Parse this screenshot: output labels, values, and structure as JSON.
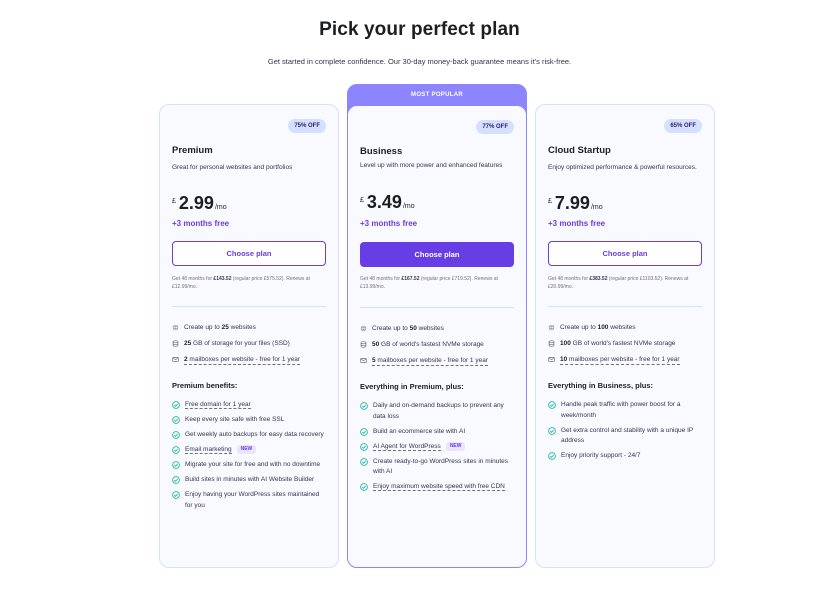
{
  "header": {
    "title": "Pick your perfect plan",
    "subtitle": "Get started in complete confidence. Our 30-day money-back guarantee means it's risk-free."
  },
  "colors": {
    "accent": "#673de6",
    "popular": "#8c85ff",
    "card_bg": "#f9faff",
    "border": "#d5dfff",
    "check": "#00b090"
  },
  "plans": {
    "premium": {
      "discount": "75% OFF",
      "name": "Premium",
      "description": "Great for personal websites and portfolios",
      "currency": "£",
      "price": "2.99",
      "per": "/mo",
      "months_free": "+3 months free",
      "button": "Choose plan",
      "renew_prefix": "Get 48 months for ",
      "renew_amount": "£143.52",
      "renew_suffix": " (regular price £575.52). Renews at £12.99/mo.",
      "features": [
        {
          "pre": "Create up to ",
          "bold": "25",
          "post": " websites",
          "icon": "globe-icon"
        },
        {
          "pre": "",
          "bold": "25",
          "post": " GB of storage for your files (SSD)",
          "icon": "storage-icon"
        },
        {
          "pre": "",
          "bold": "2",
          "post": " mailboxes per website - free for 1 year",
          "icon": "mail-icon"
        }
      ],
      "benefits_title": "Premium benefits:",
      "benefits": [
        {
          "text": "Free domain for 1 year",
          "new": ""
        },
        {
          "text": "Keep every site safe with free SSL",
          "new": ""
        },
        {
          "text": "Get weekly auto backups for easy data recovery",
          "new": ""
        },
        {
          "text": "Email marketing",
          "new": "NEW"
        },
        {
          "text": "Migrate your site for free and with no downtime",
          "new": ""
        },
        {
          "text": "Build sites in minutes with AI Website Builder",
          "new": ""
        },
        {
          "text": "Enjoy having your WordPress sites maintained for you",
          "new": ""
        }
      ]
    },
    "business": {
      "banner": "MOST POPULAR",
      "discount": "77% OFF",
      "name": "Business",
      "description": "Level up with more power and enhanced features",
      "currency": "£",
      "price": "3.49",
      "per": "/mo",
      "months_free": "+3 months free",
      "button": "Choose plan",
      "renew_prefix": "Get 48 months for ",
      "renew_amount": "£167.52",
      "renew_suffix": " (regular price £719.52). Renews at £13.99/mo.",
      "features": [
        {
          "pre": "Create up to ",
          "bold": "50",
          "post": " websites",
          "icon": "globe-icon"
        },
        {
          "pre": "",
          "bold": "50",
          "post": " GB of world's fastest NVMe storage",
          "icon": "storage-icon"
        },
        {
          "pre": "",
          "bold": "5",
          "post": " mailboxes per website - free for 1 year",
          "icon": "mail-icon"
        }
      ],
      "benefits_title": "Everything in Premium, plus:",
      "benefits": [
        {
          "text": "Daily and on-demand backups to prevent any data loss",
          "new": ""
        },
        {
          "text": "Build an ecommerce site with AI",
          "new": ""
        },
        {
          "text": "AI Agent for WordPress",
          "new": "NEW"
        },
        {
          "text": "Create ready-to-go WordPress sites in minutes with AI",
          "new": ""
        },
        {
          "text": "Enjoy maximum website speed with free CDN",
          "new": ""
        }
      ]
    },
    "cloud": {
      "discount": "65% OFF",
      "name": "Cloud Startup",
      "description": "Enjoy optimized performance & powerful resources.",
      "currency": "£",
      "price": "7.99",
      "per": "/mo",
      "months_free": "+3 months free",
      "button": "Choose plan",
      "renew_prefix": "Get 48 months for ",
      "renew_amount": "£383.52",
      "renew_suffix": " (regular price £1103.52). Renews at £20.99/mo.",
      "features": [
        {
          "pre": "Create up to ",
          "bold": "100",
          "post": " websites",
          "icon": "globe-icon"
        },
        {
          "pre": "",
          "bold": "100",
          "post": " GB of world's fastest NVMe storage",
          "icon": "storage-icon"
        },
        {
          "pre": "",
          "bold": "10",
          "post": " mailboxes per website - free for 1 year",
          "icon": "mail-icon"
        }
      ],
      "benefits_title": "Everything in Business, plus:",
      "benefits": [
        {
          "text": "Handle peak traffic with power boost for a week/month",
          "new": ""
        },
        {
          "text": "Get extra control and stability with a unique IP address",
          "new": ""
        },
        {
          "text": "Enjoy priority support - 24/7",
          "new": ""
        }
      ]
    }
  }
}
